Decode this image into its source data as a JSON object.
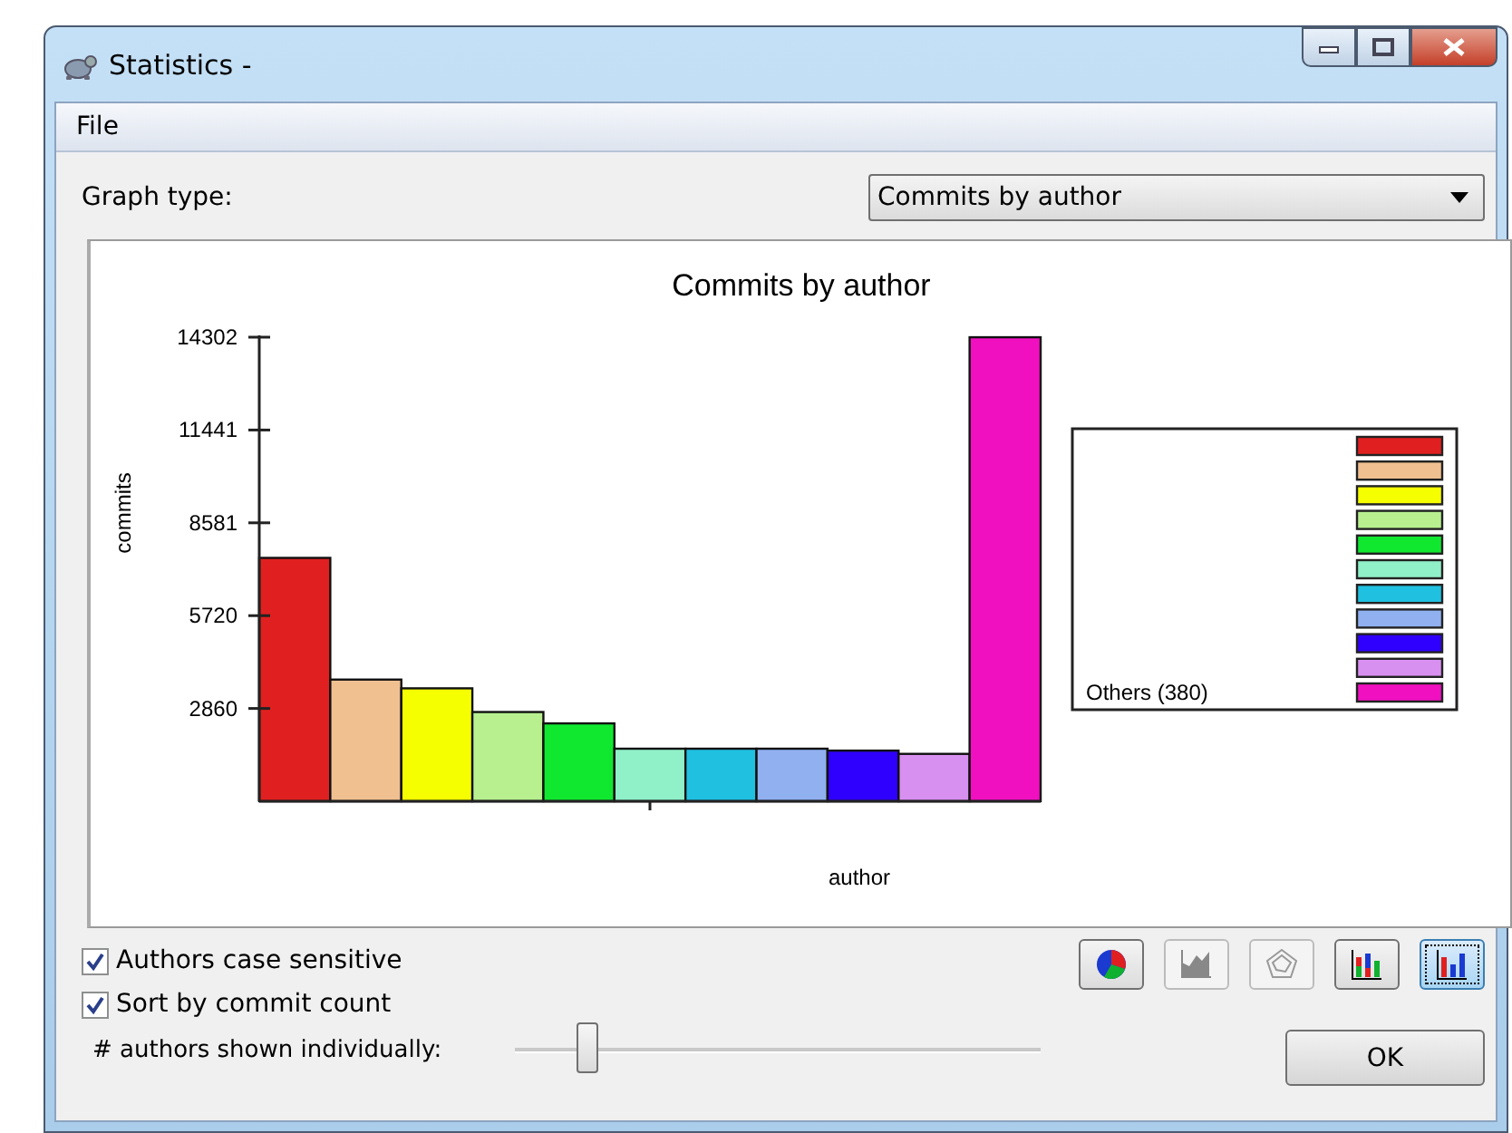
{
  "window": {
    "title": "Statistics -"
  },
  "menu": [
    "File"
  ],
  "graph_type": {
    "label": "Graph type:",
    "value": "Commits by author"
  },
  "chart": {
    "chart_data": {
      "type": "bar",
      "title": "Commits by author",
      "xlabel": "author",
      "ylabel": "commits",
      "ylim": [
        0,
        14302
      ],
      "yticks": [
        2860,
        5720,
        8581,
        11441,
        14302
      ],
      "series": [
        {
          "color": "#e02020",
          "values": [
            7500
          ]
        },
        {
          "color": "#f0c090",
          "values": [
            3750
          ]
        },
        {
          "color": "#f5ff00",
          "values": [
            3480
          ]
        },
        {
          "color": "#b8f090",
          "values": [
            2750
          ]
        },
        {
          "color": "#10e830",
          "values": [
            2400
          ]
        },
        {
          "color": "#90f0c8",
          "values": [
            1620
          ]
        },
        {
          "color": "#20c0e0",
          "values": [
            1620
          ]
        },
        {
          "color": "#90b0f0",
          "values": [
            1620
          ]
        },
        {
          "color": "#3000ff",
          "values": [
            1560
          ]
        },
        {
          "color": "#d890f0",
          "values": [
            1460
          ]
        },
        {
          "name": "Others (380)",
          "color": "#f010c0",
          "values": [
            14300
          ]
        }
      ]
    }
  },
  "options": [
    {
      "label": "Authors case sensitive",
      "checked": true
    },
    {
      "label": "Sort by commit count",
      "checked": true
    }
  ],
  "chart_buttons": [
    {
      "kind": "pie",
      "disabled": false,
      "selected": false
    },
    {
      "kind": "area",
      "disabled": true,
      "selected": false
    },
    {
      "kind": "radar",
      "disabled": true,
      "selected": false
    },
    {
      "kind": "stacked",
      "disabled": false,
      "selected": false
    },
    {
      "kind": "bar",
      "disabled": false,
      "selected": true
    }
  ],
  "authors_slider": {
    "label": "# authors shown individually:",
    "level": 0.12
  },
  "buttons": [
    "OK"
  ]
}
